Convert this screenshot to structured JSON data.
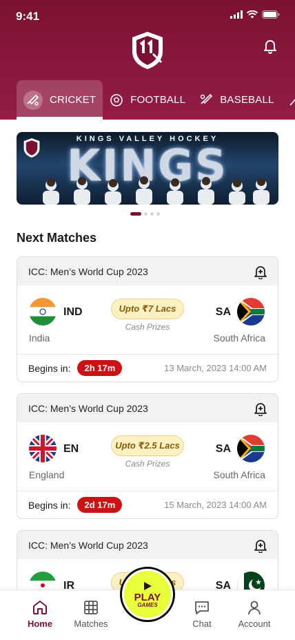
{
  "status": {
    "time": "9:41"
  },
  "tabs": [
    {
      "label": "CRICKET",
      "icon": "cricket-bat-icon",
      "active": true
    },
    {
      "label": "FOOTBALL",
      "icon": "football-icon",
      "active": false
    },
    {
      "label": "BASEBALL",
      "icon": "baseball-icon",
      "active": false
    }
  ],
  "banner": {
    "subtitle": "KINGS VALLEY HOCKEY",
    "title": "KINGS"
  },
  "section": {
    "title": "Next Matches"
  },
  "matches": [
    {
      "tournament": "ICC: Men’s World Cup 2023",
      "home_code": "IND",
      "home_name": "India",
      "away_code": "SA",
      "away_name": "South Africa",
      "prize": "Upto ₹7 Lacs",
      "prize_note": "Cash Prizes",
      "begins_label": "Begins in:",
      "countdown": "2h 17m",
      "datetime": "13 March, 2023 14:00 AM"
    },
    {
      "tournament": "ICC: Men’s World Cup 2023",
      "home_code": "EN",
      "home_name": "England",
      "away_code": "SA",
      "away_name": "South Africa",
      "prize": "Upto ₹2.5 Lacs",
      "prize_note": "Cash Prizes",
      "begins_label": "Begins in:",
      "countdown": "2d 17m",
      "datetime": "15 March, 2023 14:00 AM"
    },
    {
      "tournament": "ICC: Men’s World Cup 2023",
      "home_code": "IR",
      "home_name": "",
      "away_code": "SA",
      "away_name": "",
      "prize": "Upto ₹2 Lacs",
      "prize_note": "",
      "begins_label": "",
      "countdown": "",
      "datetime": ""
    }
  ],
  "nav": {
    "home": "Home",
    "matches": "Matches",
    "play": "PLAY",
    "play_sub": "GAMES",
    "chat": "Chat",
    "account": "Account"
  },
  "colors": {
    "brand": "#7a1131",
    "accent": "#e8ff3a",
    "countdown": "#cc1212"
  }
}
